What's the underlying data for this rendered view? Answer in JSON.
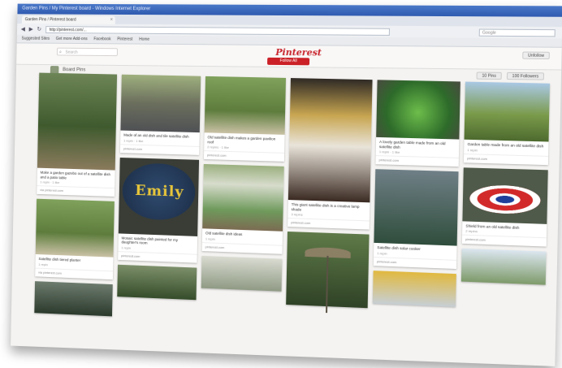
{
  "browser": {
    "title": "Garden Pins / My Pinterest board - Windows Internet Explorer",
    "tab_label": "Garden Pins / Pinterest board",
    "address": "http://pinterest.com/...",
    "search_placeholder": "Google",
    "bookmarks": [
      "Suggested Sites",
      "Get more Add-ons",
      "Facebook",
      "Pinterest",
      "Home"
    ]
  },
  "pinterest": {
    "logo": "Pinterest",
    "search_placeholder": "Search",
    "follow_button": "Follow All",
    "right_button": "Unfollow",
    "user_name": "Board Pins",
    "pins_button": "10 Pins",
    "likes_button": "100 Followers"
  },
  "pins": [
    [
      {
        "desc": "Make a garden gazebo out of a satellite dish and a patio table",
        "meta": "1 repin · 1 like",
        "foot": "via pinterest.com",
        "img": "g1"
      },
      {
        "desc": "Satellite dish tiered planter",
        "meta": "1 repin",
        "foot": "via pinterest.com",
        "img": "g3"
      },
      {
        "desc": "",
        "meta": "",
        "foot": "",
        "img": "g11"
      }
    ],
    [
      {
        "desc": "Made of an old dish and tile satellite dish",
        "meta": "1 repin · 1 like",
        "foot": "pinterest.com",
        "img": "g2"
      },
      {
        "desc": "Mosaic satellite dish painted for my daughter's room",
        "meta": "1 repin",
        "foot": "pinterest.com",
        "img": "emily"
      },
      {
        "desc": "",
        "meta": "",
        "foot": "",
        "img": "g12"
      }
    ],
    [
      {
        "desc": "Old satellite dish makes a garden pavilion roof",
        "meta": "2 repins · 1 like",
        "foot": "pinterest.com",
        "img": "g3"
      },
      {
        "desc": "Old satellite dish ideas",
        "meta": "1 repin",
        "foot": "pinterest.com",
        "img": "g7"
      },
      {
        "desc": "",
        "meta": "",
        "foot": "",
        "img": "g13"
      }
    ],
    [
      {
        "desc": "This giant satellite dish is a creative lamp shade",
        "meta": "3 repins",
        "foot": "pinterest.com",
        "img": "g4"
      },
      {
        "desc": "",
        "meta": "",
        "foot": "",
        "img": "umb"
      }
    ],
    [
      {
        "desc": "A lovely garden table made from an old satellite dish",
        "meta": "1 repin · 1 like",
        "foot": "pinterest.com",
        "img": "g5"
      },
      {
        "desc": "Satellite dish solar cooker",
        "meta": "1 repin",
        "foot": "pinterest.com",
        "img": "g8"
      },
      {
        "desc": "",
        "meta": "",
        "foot": "",
        "img": "g16"
      }
    ],
    [
      {
        "desc": "Garden table made from an old satellite dish",
        "meta": "1 repin",
        "foot": "pinterest.com",
        "img": "g6"
      },
      {
        "desc": "Shield from an old satellite dish",
        "meta": "2 repins",
        "foot": "pinterest.com",
        "img": "shield"
      },
      {
        "desc": "",
        "meta": "",
        "foot": "",
        "img": "g17"
      }
    ]
  ]
}
